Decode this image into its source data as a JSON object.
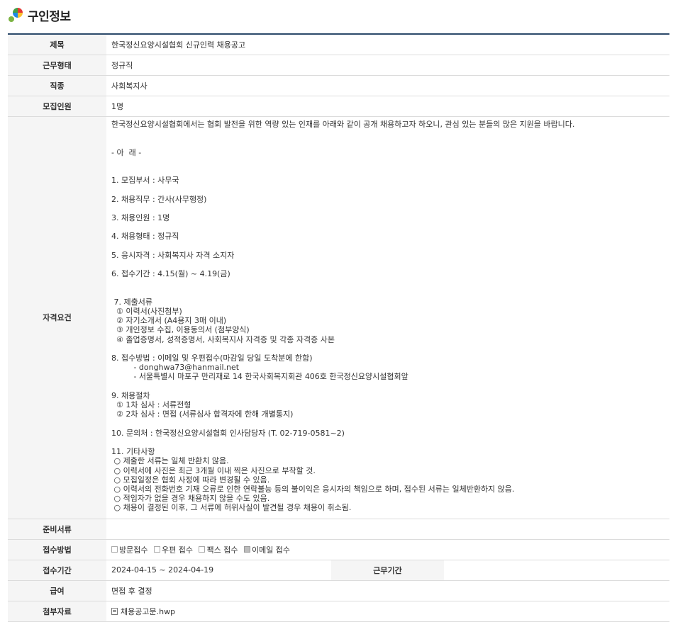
{
  "header": {
    "title": "구인정보"
  },
  "fields": {
    "title_label": "제목",
    "title_value": "한국정신요양시설협회 신규인력 채용공고",
    "worktype_label": "근무형태",
    "worktype_value": "정규직",
    "job_label": "직종",
    "job_value": "사회복지사",
    "headcount_label": "모집인원",
    "headcount_value": "1명",
    "qualification_label": "자격요건",
    "qualification_lines": [
      "한국정신요양시설협회에서는 협회 발전을 위한 역량 있는 인재를 아래와 같이 공개 채용하고자 하오니, 관심 있는 분들의 많은 지원을 바랍니다.",
      "",
      "",
      "- 아  래 -",
      "",
      "",
      "1. 모집부서 : 사무국",
      "",
      "2. 채용직무 : 간사(사무행정)",
      "",
      "3. 채용인원 : 1명",
      "",
      "4. 채용형태 : 정규직",
      "",
      "5. 응시자격 : 사회복지사 자격 소지자",
      "",
      "6. 접수기간 : 4.15(월) ~ 4.19(금)",
      "",
      "",
      " 7. 제출서류",
      "  ① 이력서(사진첨부)",
      "  ② 자기소개서 (A4용지 3매 이내)",
      "  ③ 개인정보 수집, 이용동의서 (첨부양식)",
      "  ④ 졸업증명서, 성적증명서, 사회복지사 자격증 및 각종 자격증 사본",
      "",
      "8. 접수방법 : 이메일 및 우편접수(마감일 당일 도착분에 한함)",
      "         - donghwa73@hanmail.net",
      "         - 서울특별시 마포구 만리재로 14 한국사회복지회관 406호 한국정신요양시설협회앞",
      "",
      "9. 채용절차",
      "  ① 1차 심사 : 서류전형",
      "  ② 2차 심사 : 면접 (서류심사 합격자에 한해 개별통지)",
      "",
      "10. 문의처 : 한국정신요양시설협회 인사담당자 (T. 02-719-0581~2)",
      "",
      "11. 기타사항",
      " ○ 제출한 서류는 일체 반환치 않음.",
      " ○ 이력서에 사진은 최근 3개월 이내 찍은 사진으로 부착할 것.",
      " ○ 모집일정은 협회 사정에 따라 변경될 수 있음.",
      " ○ 이력서의 전화번호 기재 오류로 인한 연락불능 등의 불이익은 응시자의 책임으로 하며, 접수된 서류는 일체반환하지 않음.",
      " ○ 적임자가 없을 경우 채용하지 않을 수도 있음.",
      " ○ 채용이 결정된 이후, 그 서류에 허위사실이 발견될 경우 채용이 취소됨."
    ],
    "documents_label": "준비서류",
    "documents_value": "",
    "method_label": "접수방법",
    "method_options": [
      {
        "label": "방문접수",
        "checked": false
      },
      {
        "label": "우편 접수",
        "checked": false
      },
      {
        "label": "팩스 접수",
        "checked": false
      },
      {
        "label": "이메일 접수",
        "checked": true
      }
    ],
    "period_label": "접수기간",
    "period_value": "2024-04-15 ~ 2024-04-19",
    "workperiod_label": "근무기간",
    "workperiod_value": "",
    "salary_label": "급여",
    "salary_value": "면접 후 결정",
    "attachment_label": "첨부자료",
    "attachment_file": "채용공고문.hwp"
  }
}
